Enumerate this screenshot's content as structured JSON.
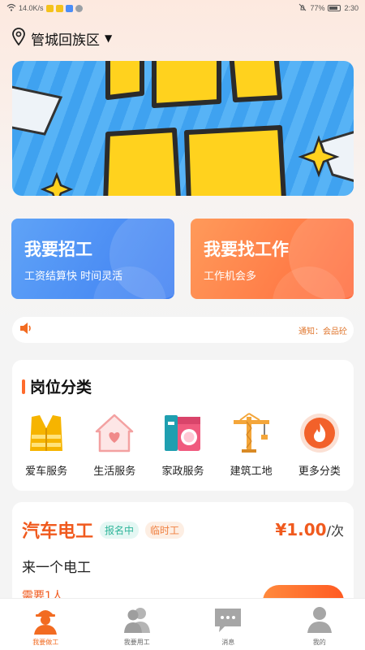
{
  "status_bar": {
    "speed": "14.0K/s",
    "battery": "77%",
    "time": "2:30"
  },
  "location": {
    "name": "管城回族区"
  },
  "action_cards": [
    {
      "title": "我要招工",
      "subtitle": "工资结算快 时间灵活"
    },
    {
      "title": "我要找工作",
      "subtitle": "工作机会多"
    }
  ],
  "notice": {
    "text": "通知：会品砼"
  },
  "categories": {
    "title": "岗位分类",
    "items": [
      {
        "label": "爱车服务",
        "icon": "vest-icon"
      },
      {
        "label": "生活服务",
        "icon": "house-heart-icon"
      },
      {
        "label": "家政服务",
        "icon": "washing-machine-icon"
      },
      {
        "label": "建筑工地",
        "icon": "tower-crane-icon"
      },
      {
        "label": "更多分类",
        "icon": "fire-icon"
      }
    ]
  },
  "job": {
    "title": "汽车电工",
    "tags": [
      "报名中",
      "临时工"
    ],
    "price": "¥1.00",
    "unit": "/次",
    "desc": "来一个电工",
    "need": "需要1人"
  },
  "nav": [
    {
      "label": "我要做工",
      "active": true
    },
    {
      "label": "我要用工",
      "active": false
    },
    {
      "label": "消息",
      "active": false
    },
    {
      "label": "我的",
      "active": false
    }
  ],
  "colors": {
    "accent": "#f05a1e",
    "blue": "#3f7ff2",
    "orange": "#ff6b3d"
  }
}
